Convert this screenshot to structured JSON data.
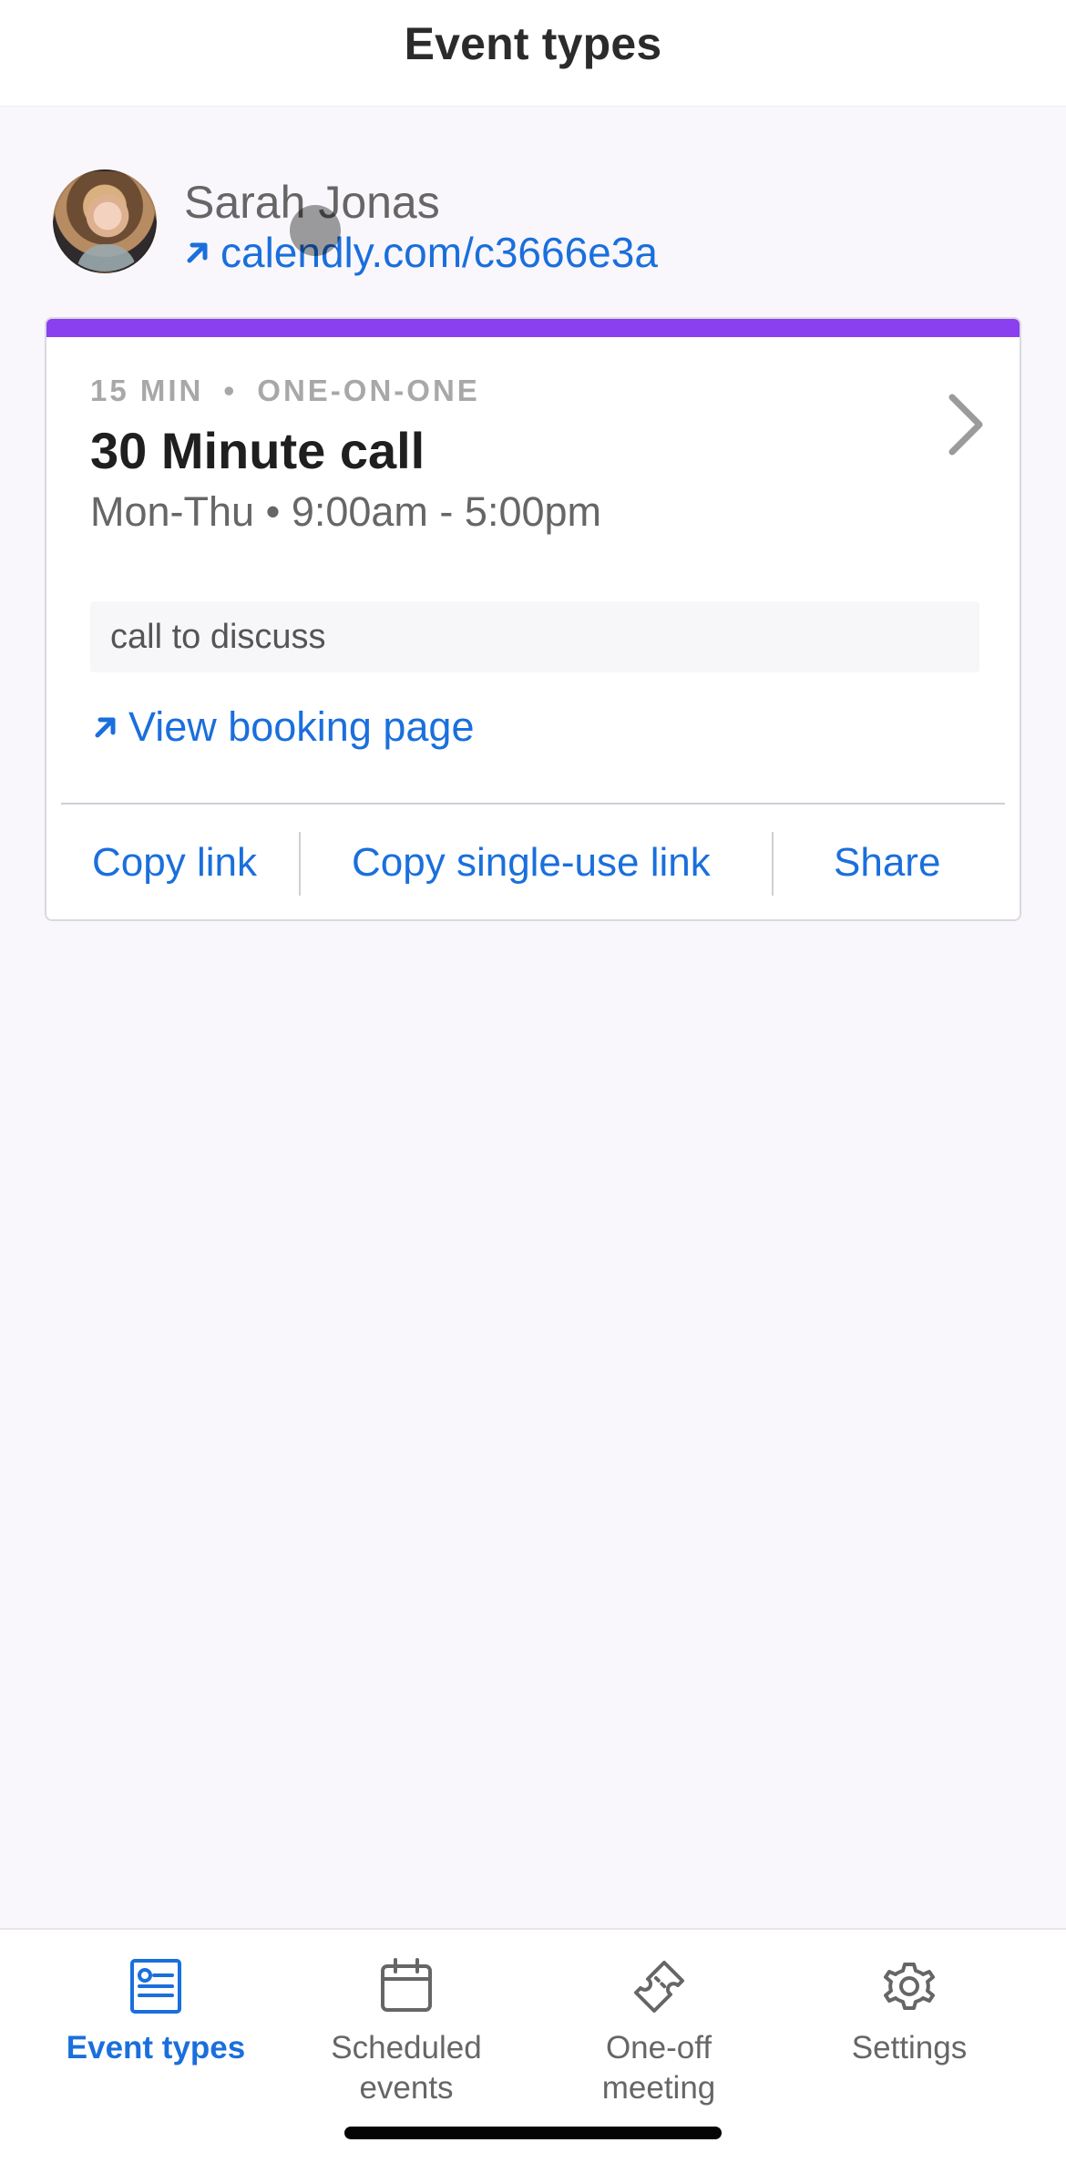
{
  "header": {
    "title": "Event types"
  },
  "profile": {
    "name": "Sarah Jonas",
    "link_text": "calendly.com/c3666e3a",
    "avatar_icon": "avatar-image",
    "link_icon": "external-link-arrow-icon"
  },
  "event": {
    "duration": "15 MIN",
    "type": "ONE-ON-ONE",
    "title": "30 Minute call",
    "availability": "Mon-Thu • 9:00am - 5:00pm",
    "description": "call to discuss",
    "booking_link_text": "View booking page",
    "accent_color": "#8a40ee",
    "chevron_icon": "chevron-right-icon",
    "booking_link_icon": "external-link-arrow-icon"
  },
  "actions": {
    "copy_link": "Copy link",
    "copy_single_use_link": "Copy single-use link",
    "share": "Share"
  },
  "bottom_nav": {
    "items": [
      {
        "label": "Event types",
        "icon": "event-types-icon",
        "active": true
      },
      {
        "label": "Scheduled\nevents",
        "icon": "calendar-icon",
        "active": false
      },
      {
        "label": "One-off\nmeeting",
        "icon": "ticket-icon",
        "active": false
      },
      {
        "label": "Settings",
        "icon": "gear-icon",
        "active": false
      }
    ]
  },
  "colors": {
    "background": "#f9f7fb",
    "link_blue": "#1a6fdc",
    "text_dark": "#1f1f1f",
    "text_muted": "#666666"
  }
}
